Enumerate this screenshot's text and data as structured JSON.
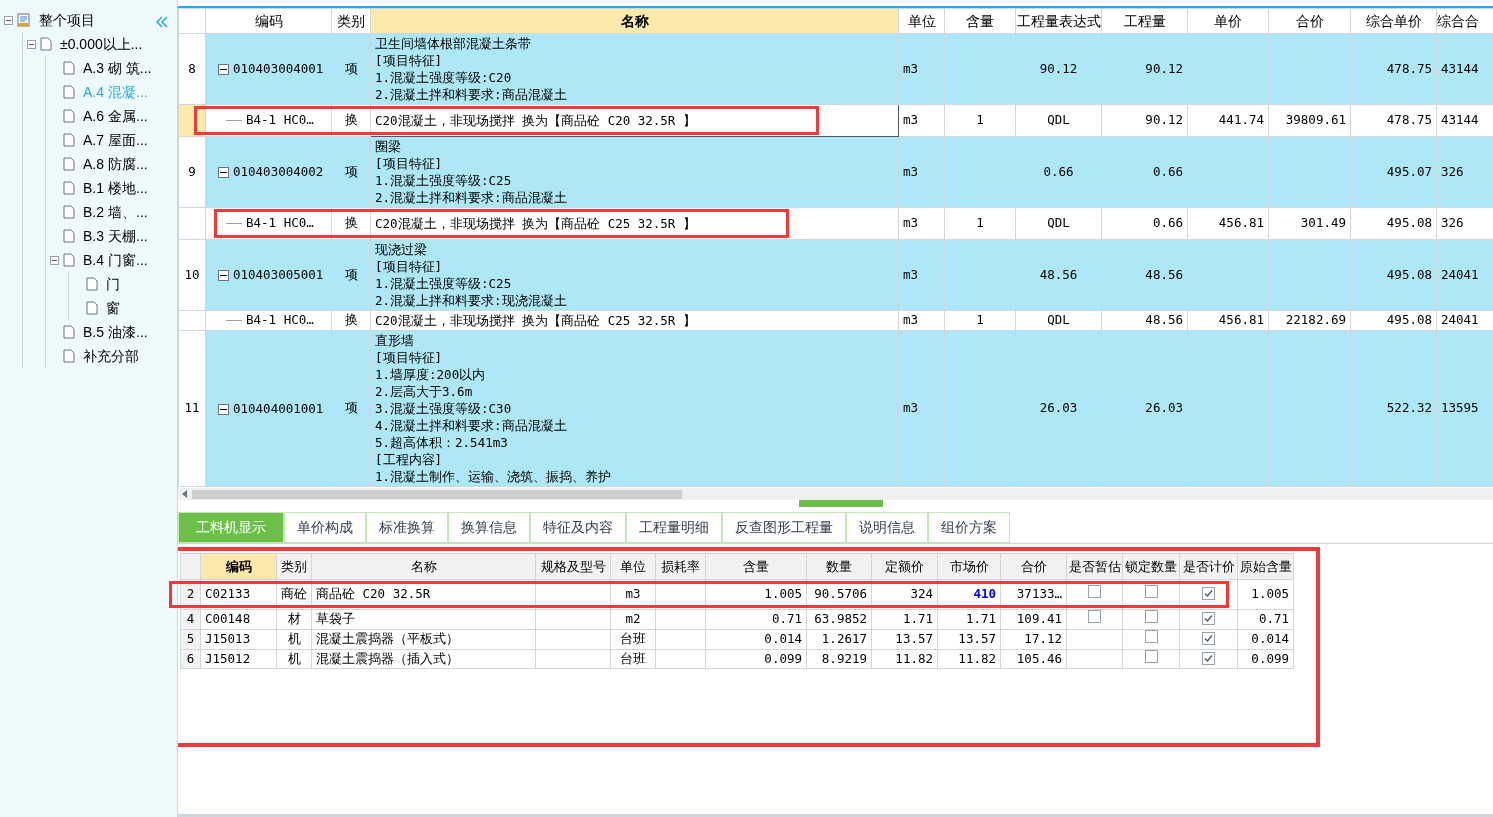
{
  "sidebar": {
    "tree": [
      {
        "label": "整个项目",
        "expanded": true,
        "selected": false,
        "children": [
          {
            "label": "±0.000以上...",
            "expanded": true,
            "selected": false,
            "children": [
              {
                "label": "A.3  砌 筑...",
                "selected": false
              },
              {
                "label": "A.4  混凝...",
                "selected": true
              },
              {
                "label": "A.6  金属...",
                "selected": false
              },
              {
                "label": "A.7  屋面...",
                "selected": false
              },
              {
                "label": "A.8  防腐...",
                "selected": false
              },
              {
                "label": "B.1  楼地...",
                "selected": false
              },
              {
                "label": "B.2  墙、...",
                "selected": false
              },
              {
                "label": "B.3  天棚...",
                "selected": false
              },
              {
                "label": "B.4  门窗...",
                "expanded": true,
                "selected": false,
                "children": [
                  {
                    "label": "门",
                    "selected": false
                  },
                  {
                    "label": "窗",
                    "selected": false
                  }
                ]
              },
              {
                "label": "B.5  油漆...",
                "selected": false
              },
              {
                "label": "补充分部",
                "selected": false
              }
            ]
          }
        ]
      }
    ]
  },
  "top_table": {
    "columns": [
      {
        "label": "编码",
        "selected": false
      },
      {
        "label": "类别",
        "selected": false
      },
      {
        "label": "名称",
        "selected": true
      },
      {
        "label": "单位",
        "selected": false
      },
      {
        "label": "含量",
        "selected": false
      },
      {
        "label": "工程量表达式",
        "selected": false
      },
      {
        "label": "工程量",
        "selected": false
      },
      {
        "label": "单价",
        "selected": false
      },
      {
        "label": "合价",
        "selected": false
      },
      {
        "label": "综合单价",
        "selected": false
      },
      {
        "label": "综合合",
        "selected": false
      }
    ],
    "rows": [
      {
        "kind": "item",
        "number": "8",
        "expanded": true,
        "selected": false,
        "code": "010403004001",
        "type": "项",
        "name_lines": [
          "卫生间墙体根部混凝土条带",
          "[项目特征]",
          "1.混凝土强度等级:C20",
          "2.混凝土拌和料要求:商品混凝土"
        ],
        "unit": "m3",
        "content": "",
        "expression": "90.12",
        "quantity": "90.12",
        "unit_price": "",
        "total": "",
        "composite_price": "478.75",
        "composite_total": "43144"
      },
      {
        "kind": "sub",
        "selected": true,
        "code": "B4-1 HC0…",
        "type": "换",
        "name_lines": [
          "C20混凝土，非现场搅拌  换为【商品砼 C20 32.5R 】"
        ],
        "unit": "m3",
        "content": "1",
        "expression": "QDL",
        "quantity": "90.12",
        "unit_price": "441.74",
        "total": "39809.61",
        "composite_price": "478.75",
        "composite_total": "43144"
      },
      {
        "kind": "item",
        "number": "9",
        "expanded": true,
        "selected": false,
        "code": "010403004002",
        "type": "项",
        "name_lines": [
          "圈梁",
          "[项目特征]",
          "1.混凝土强度等级:C25",
          "2.混凝土拌和料要求:商品混凝土"
        ],
        "unit": "m3",
        "content": "",
        "expression": "0.66",
        "quantity": "0.66",
        "unit_price": "",
        "total": "",
        "composite_price": "495.07",
        "composite_total": "326"
      },
      {
        "kind": "sub",
        "selected": false,
        "code": "B4-1 HC0…",
        "type": "换",
        "name_lines": [
          "C20混凝土，非现场搅拌  换为【商品砼 C25 32.5R 】"
        ],
        "unit": "m3",
        "content": "1",
        "expression": "QDL",
        "quantity": "0.66",
        "unit_price": "456.81",
        "total": "301.49",
        "composite_price": "495.08",
        "composite_total": "326"
      },
      {
        "kind": "item",
        "number": "10",
        "expanded": true,
        "selected": false,
        "code": "010403005001",
        "type": "项",
        "name_lines": [
          "现浇过梁",
          "[项目特征]",
          "1.混凝土强度等级:C25",
          "2.混凝上拌和料要求:现浇混凝土"
        ],
        "unit": "m3",
        "content": "",
        "expression": "48.56",
        "quantity": "48.56",
        "unit_price": "",
        "total": "",
        "composite_price": "495.08",
        "composite_total": "24041"
      },
      {
        "kind": "sub",
        "selected": false,
        "code": "B4-1 HC0…",
        "type": "换",
        "name_lines": [
          "C20混凝土，非现场搅拌  换为【商品砼 C25 32.5R 】"
        ],
        "unit": "m3",
        "content": "1",
        "expression": "QDL",
        "quantity": "48.56",
        "unit_price": "456.81",
        "total": "22182.69",
        "composite_price": "495.08",
        "composite_total": "24041"
      },
      {
        "kind": "item",
        "number": "11",
        "expanded": true,
        "selected": false,
        "code": "010404001001",
        "type": "项",
        "name_lines": [
          "直形墙",
          "[项目特征]",
          "1.墙厚度:200以内",
          "2.层高大于3.6m",
          "3.混凝土强度等级:C30",
          "4.混凝土拌和料要求:商品混凝土",
          "5.超高体积：2.541m3",
          "[工程内容]",
          "1.混凝土制作、运输、浇筑、振捣、养护"
        ],
        "unit": "m3",
        "content": "",
        "expression": "26.03",
        "quantity": "26.03",
        "unit_price": "",
        "total": "",
        "composite_price": "522.32",
        "composite_total": "13595"
      }
    ]
  },
  "tabs": [
    {
      "label": "工料机显示",
      "selected": true
    },
    {
      "label": "单价构成",
      "selected": false
    },
    {
      "label": "标准换算",
      "selected": false
    },
    {
      "label": "换算信息",
      "selected": false
    },
    {
      "label": "特征及内容",
      "selected": false
    },
    {
      "label": "工程量明细",
      "selected": false
    },
    {
      "label": "反查图形工程量",
      "selected": false
    },
    {
      "label": "说明信息",
      "selected": false
    },
    {
      "label": "组价方案",
      "selected": false
    }
  ],
  "bottom_table": {
    "columns": [
      {
        "label": "编码",
        "selected": true
      },
      {
        "label": "类别",
        "selected": false
      },
      {
        "label": "名称",
        "selected": false
      },
      {
        "label": "规格及型号",
        "selected": false
      },
      {
        "label": "单位",
        "selected": false
      },
      {
        "label": "损耗率",
        "selected": false
      },
      {
        "label": "含量",
        "selected": false
      },
      {
        "label": "数量",
        "selected": false
      },
      {
        "label": "定额价",
        "selected": false
      },
      {
        "label": "市场价",
        "selected": false
      },
      {
        "label": "合价",
        "selected": false
      },
      {
        "label": "是否暂估",
        "selected": false
      },
      {
        "label": "锁定数量",
        "selected": false
      },
      {
        "label": "是否计价",
        "selected": false
      },
      {
        "label": "原始含量",
        "selected": false
      }
    ],
    "rows": [
      {
        "number": "2",
        "code": "C02133",
        "type": "商砼",
        "name": "商品砼 C20 32.5R",
        "spec": "",
        "unit": "m3",
        "loss": "",
        "content": "1.005",
        "amount": "90.5706",
        "base_price": "324",
        "market_price": "410",
        "market_changed": true,
        "total": "37133…",
        "provisional": false,
        "locked": false,
        "priced": true,
        "original": "1.005"
      },
      {
        "number": "4",
        "code": "C00148",
        "type": "材",
        "name": "草袋子",
        "spec": "",
        "unit": "m2",
        "loss": "",
        "content": "0.71",
        "amount": "63.9852",
        "base_price": "1.71",
        "market_price": "1.71",
        "market_changed": false,
        "total": "109.41",
        "provisional": false,
        "locked": false,
        "priced": true,
        "original": "0.71"
      },
      {
        "number": "5",
        "code": "J15013",
        "type": "机",
        "name": "混凝土震捣器（平板式）",
        "spec": "",
        "unit": "台班",
        "loss": "",
        "content": "0.014",
        "amount": "1.2617",
        "base_price": "13.57",
        "market_price": "13.57",
        "market_changed": false,
        "total": "17.12",
        "locked": false,
        "priced": true,
        "original": "0.014"
      },
      {
        "number": "6",
        "code": "J15012",
        "type": "机",
        "name": "混凝土震捣器（插入式）",
        "spec": "",
        "unit": "台班",
        "loss": "",
        "content": "0.099",
        "amount": "8.9219",
        "base_price": "11.82",
        "market_price": "11.82",
        "market_changed": false,
        "total": "105.46",
        "locked": false,
        "priced": true,
        "original": "0.099"
      }
    ]
  }
}
